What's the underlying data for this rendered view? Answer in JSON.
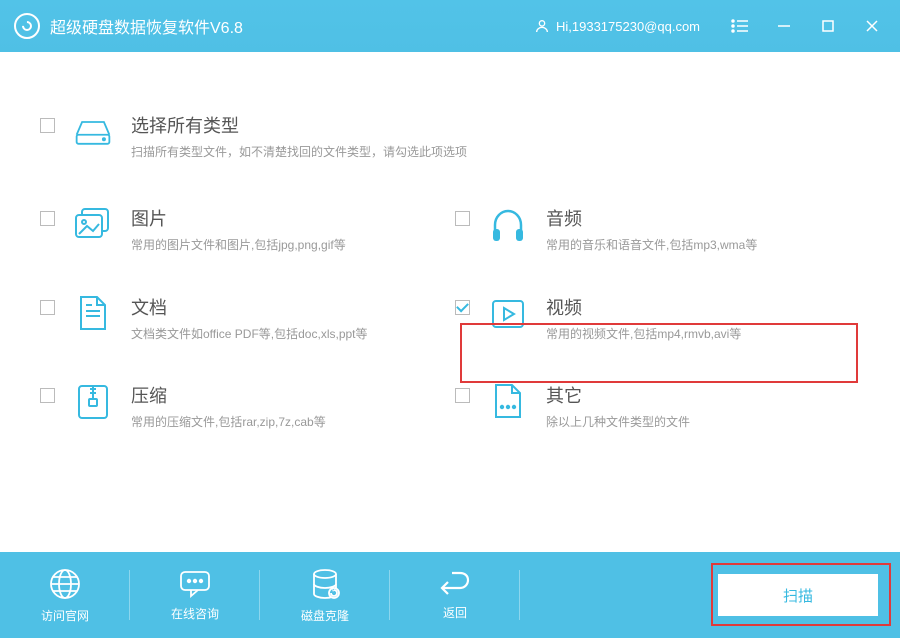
{
  "titlebar": {
    "title": "超级硬盘数据恢复软件V6.8",
    "greeting": "Hi,1933175230@qq.com"
  },
  "options": {
    "all": {
      "title": "选择所有类型",
      "desc": "扫描所有类型文件，如不清楚找回的文件类型，请勾选此项选项"
    },
    "image": {
      "title": "图片",
      "desc": "常用的图片文件和图片,包括jpg,png,gif等"
    },
    "audio": {
      "title": "音频",
      "desc": "常用的音乐和语音文件,包括mp3,wma等"
    },
    "doc": {
      "title": "文档",
      "desc": "文档类文件如office PDF等,包括doc,xls,ppt等"
    },
    "video": {
      "title": "视频",
      "desc": "常用的视频文件,包括mp4,rmvb,avi等"
    },
    "archive": {
      "title": "压缩",
      "desc": "常用的压缩文件,包括rar,zip,7z,cab等"
    },
    "other": {
      "title": "其它",
      "desc": "除以上几种文件类型的文件"
    }
  },
  "footer": {
    "website": "访问官网",
    "chat": "在线咨询",
    "clone": "磁盘克隆",
    "back": "返回",
    "scan": "扫描"
  }
}
